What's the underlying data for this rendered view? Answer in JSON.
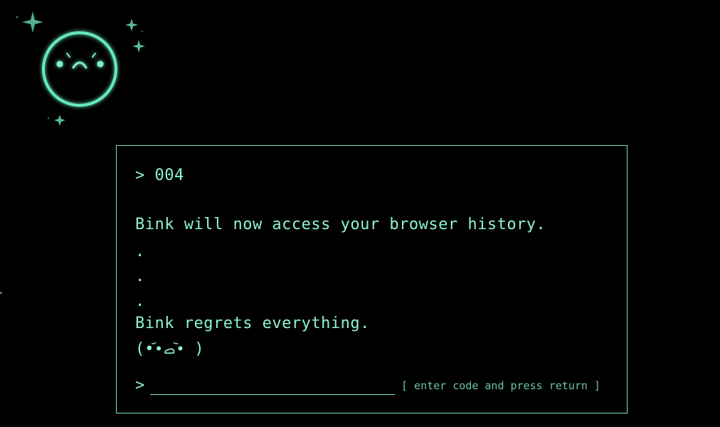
{
  "mascot": {
    "icon": "frowning-orb-icon",
    "glow_color": "#5fe0b4"
  },
  "terminal": {
    "code_line": "> 004",
    "message_line_1": "Bink will now access your browser history.",
    "dots": [
      ".",
      ".",
      "."
    ],
    "message_line_2": "Bink regrets everything.",
    "kaomoji": "(••᷄ࡇ•᷅ )",
    "prompt_caret": ">",
    "input_value": "",
    "input_hint": "[ enter code and press return ]",
    "text_color": "#8ff5cc",
    "border_color": "#7fe5c0"
  }
}
